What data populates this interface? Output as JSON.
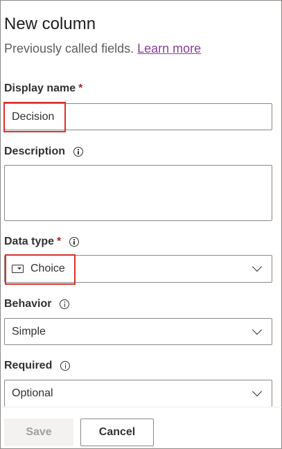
{
  "panel": {
    "title": "New column",
    "subtitle": "Previously called fields.",
    "learn_more": "Learn more"
  },
  "fields": {
    "display_name": {
      "label": "Display name",
      "required_mark": "*",
      "value": "Decision"
    },
    "description": {
      "label": "Description",
      "value": ""
    },
    "data_type": {
      "label": "Data type",
      "required_mark": "*",
      "value": "Choice",
      "icon": "choice-icon"
    },
    "behavior": {
      "label": "Behavior",
      "value": "Simple"
    },
    "required": {
      "label": "Required",
      "value": "Optional"
    }
  },
  "footer": {
    "save_label": "Save",
    "cancel_label": "Cancel"
  },
  "colors": {
    "highlight": "#d9302c",
    "required_star": "#a4262c",
    "link": "#8a3c9e"
  }
}
